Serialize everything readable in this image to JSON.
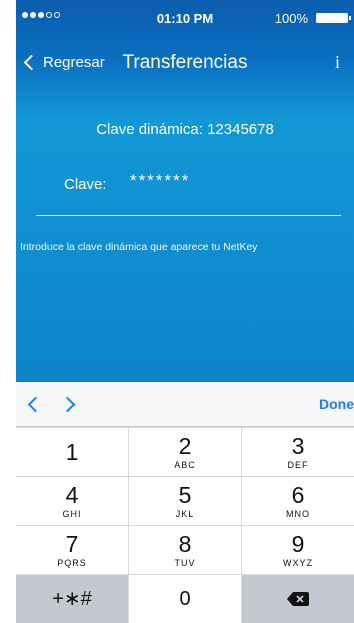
{
  "status": {
    "time": "01:10 PM",
    "battery": "100%"
  },
  "nav": {
    "back_label": "Regresar",
    "title": "Transferencias",
    "info_label": "i"
  },
  "form": {
    "dynamic_key_label": "Clave dinámica: 12345678",
    "clave_label": "Clave:",
    "clave_value": "*******",
    "hint": "Introduce la clave dinámica que aparece tu NetKey"
  },
  "keyboard": {
    "done_label": "Done",
    "keys": [
      {
        "num": "1",
        "letters": ""
      },
      {
        "num": "2",
        "letters": "ABC"
      },
      {
        "num": "3",
        "letters": "DEF"
      },
      {
        "num": "4",
        "letters": "GHI"
      },
      {
        "num": "5",
        "letters": "JKL"
      },
      {
        "num": "6",
        "letters": "MNO"
      },
      {
        "num": "7",
        "letters": "PQRS"
      },
      {
        "num": "8",
        "letters": "TUV"
      },
      {
        "num": "9",
        "letters": "WXYZ"
      }
    ],
    "symbols_label": "+∗#",
    "zero_label": "0"
  },
  "colors": {
    "header_blue": "#0b5cad",
    "body_blue": "#1298d6",
    "accent": "#1a7dfc"
  }
}
